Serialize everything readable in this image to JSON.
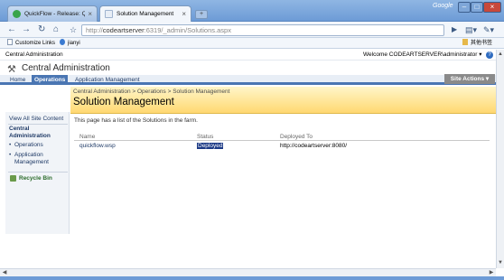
{
  "browser": {
    "brand": "Google",
    "tabs": [
      {
        "label": "QuickFlow - Release: Quick...",
        "favicon_color": "#3aa44a"
      },
      {
        "label": "Solution Management",
        "favicon_color": "#e8eef6"
      }
    ],
    "new_tab_glyph": "+",
    "address": {
      "prefix": "http://",
      "host": "codeartserver",
      "rest": ":6319/_admin/Solutions.aspx"
    },
    "bookmarks": [
      {
        "label": "Customize Links",
        "icon": "page-icon"
      },
      {
        "label": "jianyi",
        "icon": "ie-icon"
      },
      {
        "label": "其他书签",
        "icon": "folder-icon"
      }
    ]
  },
  "sharepoint": {
    "site_label": "Central Administration",
    "welcome": "Welcome CODEARTSERVER\\administrator ▾",
    "help_icon": "help-icon",
    "app_title": "Central Administration",
    "tabs": [
      {
        "label": "Home",
        "selected": false
      },
      {
        "label": "Operations",
        "selected": true
      },
      {
        "label": "Application Management",
        "selected": false
      }
    ],
    "site_actions": "Site Actions ▾",
    "leftnav": {
      "view_all": "View All Site Content",
      "header": "Central Administration",
      "items": [
        "Operations",
        "Application Management"
      ],
      "recycle": "Recycle Bin"
    },
    "breadcrumb": "Central Administration  >  Operations  >  Solution Management",
    "page_title": "Solution Management",
    "description": "This page has a list of the Solutions in the farm.",
    "table": {
      "headers": [
        "Name",
        "Status",
        "Deployed To"
      ],
      "rows": [
        {
          "name": "quickflow.wsp",
          "status": "Deployed",
          "deployed_to": "http://codeartserver:8080/"
        }
      ]
    }
  },
  "colors": {
    "accent": "#4a76b3",
    "banner": "#ffd871",
    "status_highlight": "#1c3a86"
  }
}
